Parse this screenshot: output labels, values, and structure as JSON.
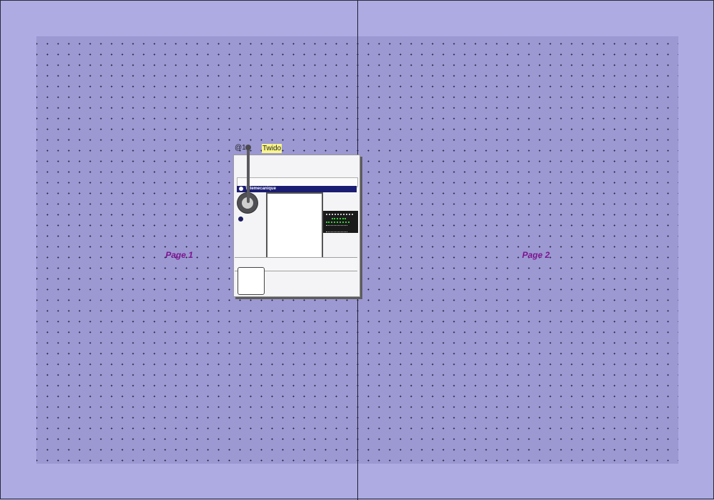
{
  "pages": [
    {
      "label": "Page 1"
    },
    {
      "label": "Page 2"
    }
  ],
  "device": {
    "address": "@1",
    "name": "Twido",
    "brand": "Telemecanique"
  },
  "colors": {
    "background": "#adabe2",
    "page_area": "#9c98d2",
    "page_label": "#7d1590",
    "name_tag": "#f9f58a",
    "brand_band": "#1b1d73"
  }
}
